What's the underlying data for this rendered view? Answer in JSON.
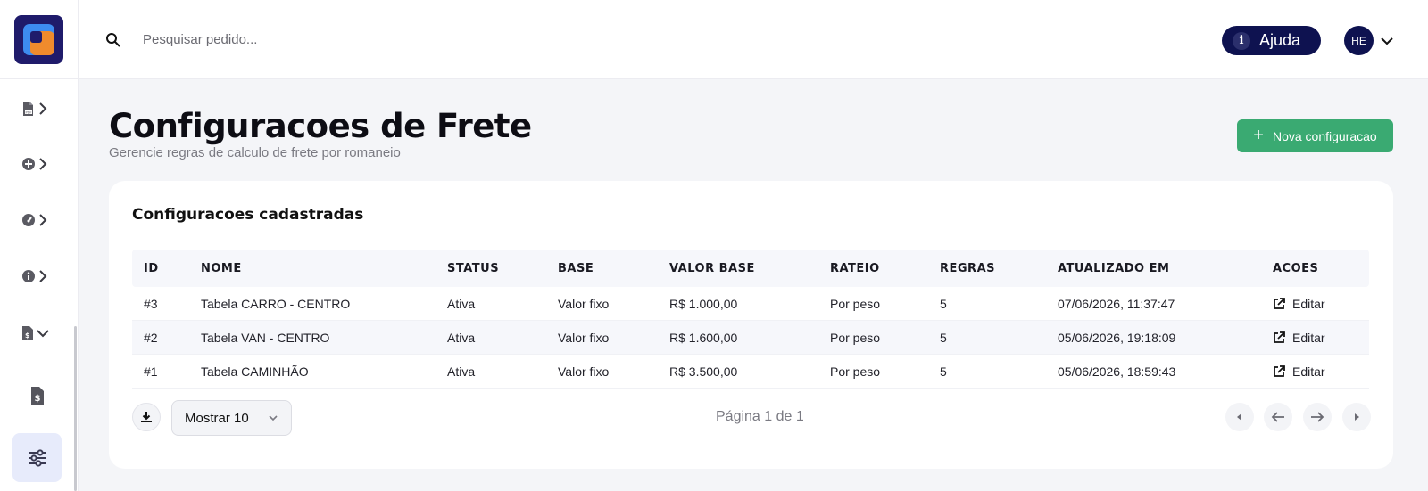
{
  "header": {
    "search_placeholder": "Pesquisar pedido...",
    "help_label": "Ajuda",
    "avatar_initials": "HE"
  },
  "page": {
    "title": "Configuracoes de Frete",
    "subtitle": "Gerencie regras de calculo de frete por romaneio",
    "new_button_label": "Nova configuracao"
  },
  "card": {
    "title": "Configuracoes cadastradas",
    "columns": [
      "ID",
      "NOME",
      "STATUS",
      "BASE",
      "VALOR BASE",
      "RATEIO",
      "REGRAS",
      "ATUALIZADO EM",
      "ACOES"
    ],
    "rows": [
      {
        "id": "#3",
        "nome": "Tabela CARRO - CENTRO",
        "status": "Ativa",
        "base": "Valor fixo",
        "valor_base": "R$ 1.000,00",
        "rateio": "Por peso",
        "regras": "5",
        "atualizado_em": "07/06/2026, 11:37:47",
        "acao": "Editar"
      },
      {
        "id": "#2",
        "nome": "Tabela VAN - CENTRO",
        "status": "Ativa",
        "base": "Valor fixo",
        "valor_base": "R$ 1.600,00",
        "rateio": "Por peso",
        "regras": "5",
        "atualizado_em": "05/06/2026, 19:18:09",
        "acao": "Editar"
      },
      {
        "id": "#1",
        "nome": "Tabela CAMINHÃO",
        "status": "Ativa",
        "base": "Valor fixo",
        "valor_base": "R$ 3.500,00",
        "rateio": "Por peso",
        "regras": "5",
        "atualizado_em": "05/06/2026, 18:59:43",
        "acao": "Editar"
      }
    ],
    "page_size_label": "Mostrar 10",
    "page_info": "Página 1 de 1"
  },
  "colors": {
    "brand_navy": "#0e1250",
    "primary_green": "#3aaa72",
    "active_sidebar_bg": "#e7ebfb"
  }
}
